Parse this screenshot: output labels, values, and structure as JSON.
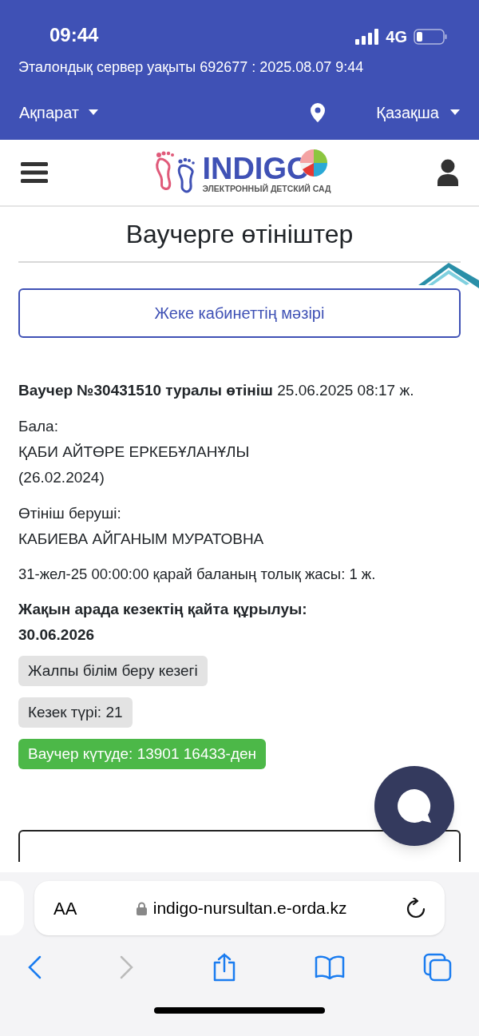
{
  "status_bar": {
    "time": "09:44",
    "network": "4G"
  },
  "server_time": "Эталондық сервер уақыты 692677 : 2025.08.07 9:44",
  "top_nav": {
    "info_menu": "Ақпарат",
    "language_menu": "Қазақша"
  },
  "logo": {
    "name": "INDIGO",
    "subtitle": "ЭЛЕКТРОННЫЙ ДЕТСКИЙ САД"
  },
  "page_title": "Ваучерге өтініштер",
  "cabinet_menu_button": "Жеке кабинеттің мәзірі",
  "application": {
    "title": "**Ваучер №30431510 туралы өтініш** 25.06.2025 08:17 ж.",
    "child_label": "Бала:",
    "child_name": "ҚАБИ АЙТӨРЕ ЕРКЕБҰЛАНҰЛЫ (26.02.2024)",
    "applicant_label": "Өтініш беруші:",
    "applicant_name": "КАБИЕВА АЙГАНЫМ МУРАТОВНА",
    "age_note": "31-жел-25 00:00:00 қарай баланың толық жасы: 1 ж.",
    "queue_rebuild": "Жақын арада кезектің қайта құрылуы: 30.06.2026",
    "tags": [
      {
        "kind": "neutral",
        "text": "Жалпы білім беру кезегі"
      },
      {
        "kind": "neutral",
        "text": "Кезек түрі: 21"
      },
      {
        "kind": "success",
        "text": "Ваучер күтуде: 13901 16433-ден"
      }
    ]
  },
  "browser": {
    "text_size_button": "AA",
    "url": "indigo-nursultan.e-orda.kz"
  }
}
